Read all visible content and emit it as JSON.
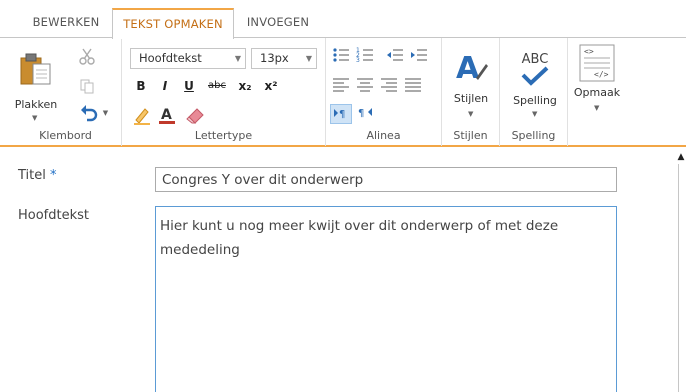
{
  "tabs": {
    "bewerken": "BEWERKEN",
    "tekst_opmaken": "TEKST OPMAKEN",
    "invoegen": "INVOEGEN"
  },
  "ribbon": {
    "klembord": {
      "group_label": "Klembord",
      "paste_label": "Plakken",
      "icons": [
        "paste-icon",
        "cut-icon",
        "copy-icon",
        "undo-icon"
      ]
    },
    "lettertype": {
      "group_label": "Lettertype",
      "font_family": "Hoofdtekst",
      "font_size": "13px",
      "bold": "B",
      "italic": "I",
      "underline": "U",
      "strikethrough": "abc",
      "subscript": "x₂",
      "superscript": "x²"
    },
    "alinea": {
      "group_label": "Alinea"
    },
    "stijlen": {
      "group_label": "Stijlen",
      "button_label": "Stijlen"
    },
    "spelling": {
      "group_label": "Spelling",
      "button_label": "Spelling",
      "icon_text": "ABC"
    },
    "opmaak": {
      "button_label": "Opmaak"
    }
  },
  "form": {
    "title_label": "Titel",
    "required_marker": "*",
    "title_value": "Congres Y over dit onderwerp",
    "body_label": "Hoofdtekst",
    "body_value": "Hier kunt u nog meer kwijt over dit onderwerp of met deze mededeling"
  },
  "colors": {
    "active_tab_accent": "#f2a646",
    "active_tab_text": "#c46f16",
    "required_marker": "#1f6fc5",
    "body_focus_border": "#5b9bd5",
    "styles_icon": "#2b6cb5",
    "spelling_check": "#2b6cb5"
  }
}
